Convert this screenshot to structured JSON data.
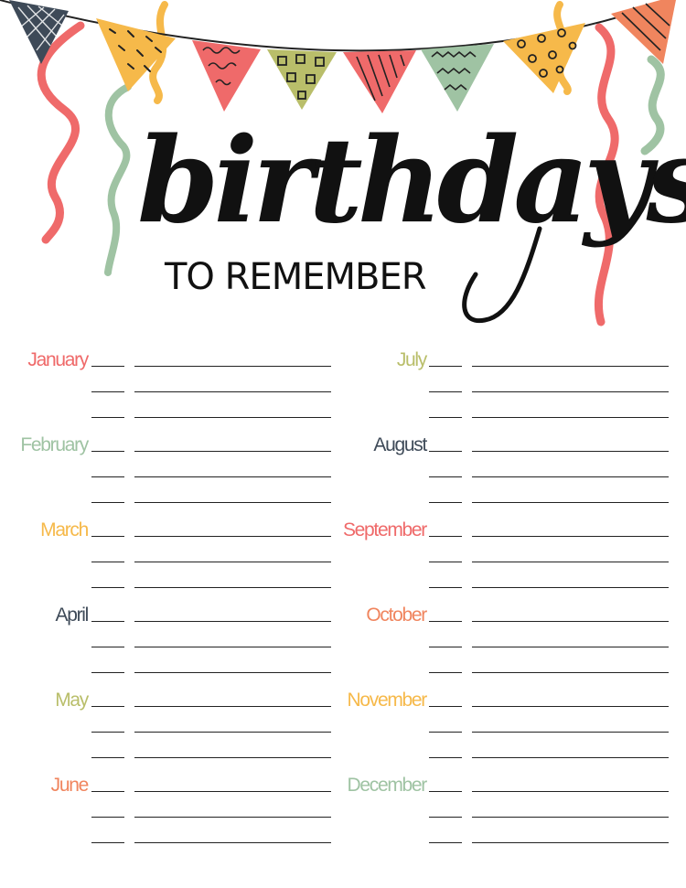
{
  "header": {
    "title": "birthdays",
    "subtitle": "TO REMEMBER"
  },
  "colors": {
    "coral": "#ef6a6a",
    "sage": "#9fc3a3",
    "mustard": "#f6b94a",
    "slate": "#3e4a58",
    "olive": "#b9be6a",
    "salmon": "#f0855e",
    "line": "#222222"
  },
  "months": {
    "left": [
      {
        "name": "January",
        "color": "#ef6a6a"
      },
      {
        "name": "February",
        "color": "#9fc3a3"
      },
      {
        "name": "March",
        "color": "#f6b94a"
      },
      {
        "name": "April",
        "color": "#3e4a58"
      },
      {
        "name": "May",
        "color": "#b9be6a"
      },
      {
        "name": "June",
        "color": "#f0855e"
      }
    ],
    "right": [
      {
        "name": "July",
        "color": "#b9be6a"
      },
      {
        "name": "August",
        "color": "#3e4a58"
      },
      {
        "name": "September",
        "color": "#ef6a6a"
      },
      {
        "name": "October",
        "color": "#f0855e"
      },
      {
        "name": "November",
        "color": "#f6b94a"
      },
      {
        "name": "December",
        "color": "#9fc3a3"
      }
    ]
  },
  "lines_per_month": 3,
  "bunting": [
    {
      "color": "#3e4a58",
      "icon": "crosshatch-pattern"
    },
    {
      "color": "#f6b94a",
      "icon": "dash-pattern"
    },
    {
      "color": "#ef6a6a",
      "icon": "swirl-pattern"
    },
    {
      "color": "#b9be6a",
      "icon": "square-pattern"
    },
    {
      "color": "#ef6a6a",
      "icon": "stripe-pattern"
    },
    {
      "color": "#9fc3a3",
      "icon": "wave-pattern"
    },
    {
      "color": "#f6b94a",
      "icon": "dot-pattern"
    },
    {
      "color": "#f0855e",
      "icon": "stripe-pattern"
    }
  ]
}
